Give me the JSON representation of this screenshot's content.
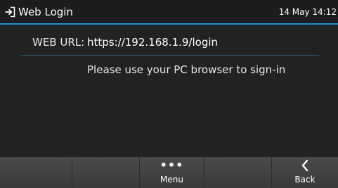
{
  "header": {
    "icon": "login-arrow-icon",
    "title": "Web Login",
    "datetime": "14 May 14:12",
    "accent_color": "#1d8fd0"
  },
  "main": {
    "url_label": "WEB URL:",
    "url_value": "https://192.168.1.9/login",
    "message": "Please use your PC browser to sign-in"
  },
  "softkeys": [
    {
      "label": "",
      "icon": ""
    },
    {
      "label": "",
      "icon": ""
    },
    {
      "label": "Menu",
      "icon": "more-dots-icon"
    },
    {
      "label": "",
      "icon": ""
    },
    {
      "label": "Back",
      "icon": "chevron-left-icon"
    }
  ]
}
